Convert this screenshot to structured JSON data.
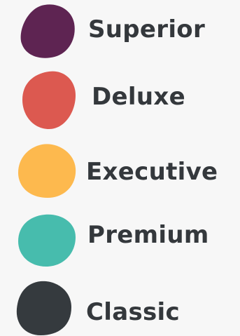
{
  "legend": {
    "items": [
      {
        "label": "Superior",
        "color": "#5e2452",
        "icon": "blob-icon"
      },
      {
        "label": "Deluxe",
        "color": "#dc5950",
        "icon": "blob-icon"
      },
      {
        "label": "Executive",
        "color": "#fdb94e",
        "icon": "blob-icon"
      },
      {
        "label": "Premium",
        "color": "#47bcad",
        "icon": "blob-icon"
      },
      {
        "label": "Classic",
        "color": "#353a3e",
        "icon": "blob-icon"
      }
    ]
  }
}
